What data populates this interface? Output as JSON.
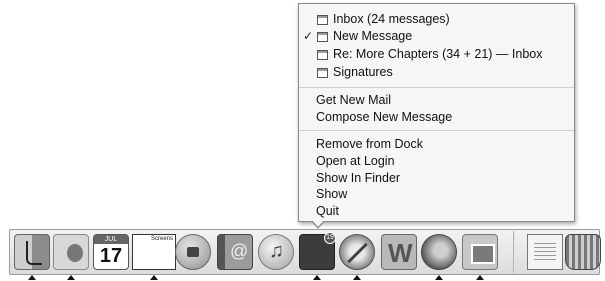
{
  "menu": {
    "windows": [
      {
        "label": "Inbox (24 messages)",
        "checked": false
      },
      {
        "label": "New Message",
        "checked": true
      },
      {
        "label": "Re: More Chapters (34 + 21) — Inbox",
        "checked": false
      },
      {
        "label": "Signatures",
        "checked": false
      }
    ],
    "actions": {
      "get_new_mail": "Get New Mail",
      "compose_new_message": "Compose New Message"
    },
    "dock_actions": {
      "remove_from_dock": "Remove from Dock",
      "open_at_login": "Open at Login",
      "show_in_finder": "Show In Finder",
      "show": "Show",
      "quit": "Quit"
    },
    "check_glyph": "✓"
  },
  "dock": {
    "icons": [
      {
        "name": "finder-icon",
        "running": true
      },
      {
        "name": "apple-icon",
        "running": true
      },
      {
        "name": "ical-icon",
        "running": false
      },
      {
        "name": "screenshot-app-icon",
        "running": true
      },
      {
        "name": "ichat-icon",
        "running": false
      },
      {
        "name": "address-book-icon",
        "running": false
      },
      {
        "name": "itunes-icon",
        "running": false
      },
      {
        "name": "mail-icon",
        "running": true
      },
      {
        "name": "safari-icon",
        "running": true
      },
      {
        "name": "word-icon",
        "running": false
      },
      {
        "name": "firefox-icon",
        "running": true
      },
      {
        "name": "iphoto-icon",
        "running": true
      },
      {
        "name": "document-icon",
        "running": false
      },
      {
        "name": "trash-icon",
        "running": false
      }
    ],
    "ical_month": "JUL",
    "ical_day": "17",
    "screen_label": "Screens",
    "mail_badge": "19"
  }
}
